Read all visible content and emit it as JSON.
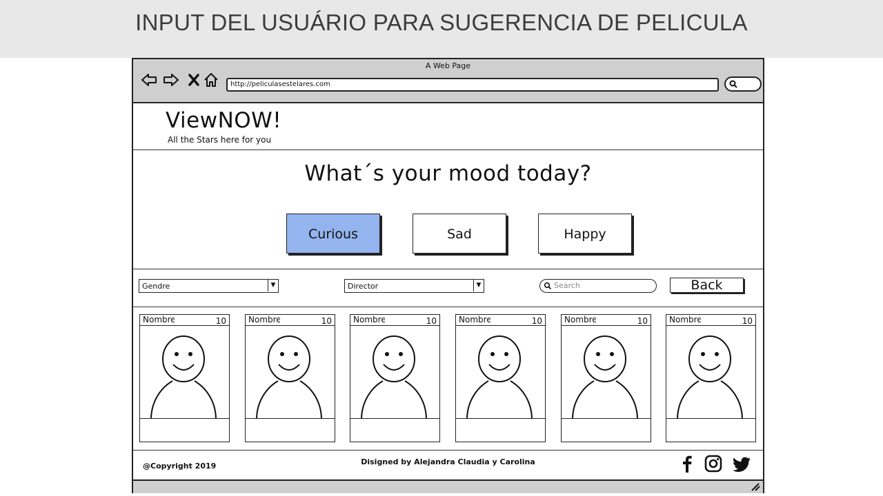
{
  "slide": {
    "title": "INPUT DEL USUÁRIO PARA SUGERENCIA DE PELICULA"
  },
  "browser": {
    "window_title": "A Web Page",
    "url": "http://peliculasestelares.com"
  },
  "site": {
    "logo": "ViewNOW!",
    "tagline": "All the Stars here for you"
  },
  "mood": {
    "question": "What´s your mood today?",
    "options": [
      "Curious",
      "Sad",
      "Happy"
    ],
    "selected": "Curious",
    "selected_color": "#93b4ef"
  },
  "filters": {
    "genre_select": "Gendre",
    "director_select": "Director",
    "search_placeholder": "Search",
    "back_label": "Back"
  },
  "movies": [
    {
      "name": "Nombre",
      "rating": "10"
    },
    {
      "name": "Nombre",
      "rating": "10"
    },
    {
      "name": "Nombre",
      "rating": "10"
    },
    {
      "name": "Nombre",
      "rating": "10"
    },
    {
      "name": "Nombre",
      "rating": "10"
    },
    {
      "name": "Nombre",
      "rating": "10"
    }
  ],
  "footer": {
    "copyright": "@Copyright 2019",
    "credits": "Disigned by Alejandra Claudia y Carolina",
    "social_icons": [
      "facebook-icon",
      "instagram-icon",
      "twitter-icon"
    ]
  }
}
